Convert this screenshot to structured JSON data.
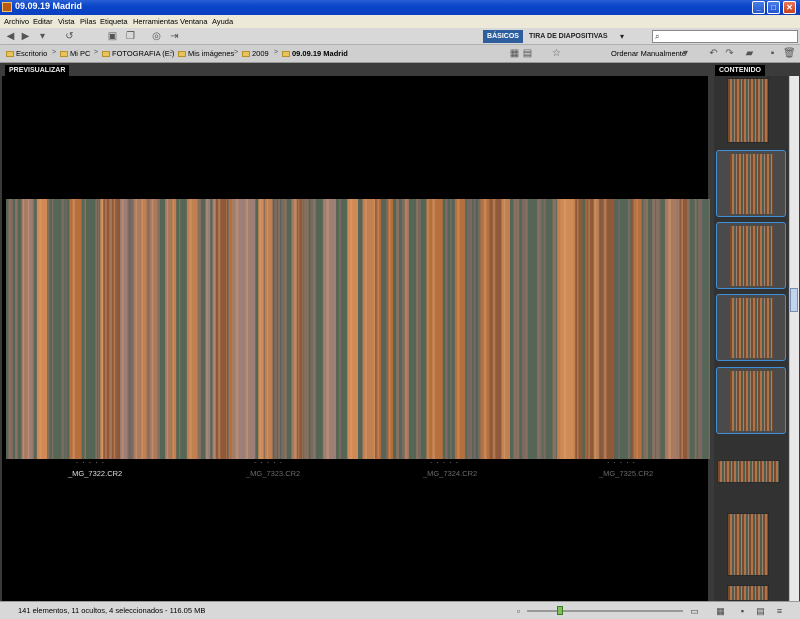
{
  "window": {
    "title": "09.09.19 Madrid"
  },
  "menu": [
    "Archivo",
    "Editar",
    "Vista",
    "Pilas",
    "Etiqueta",
    "Herramientas",
    "Ventana",
    "Ayuda"
  ],
  "toolbar": {
    "workspace_active": "BÁSICOS",
    "workspace_other": "TIRA DE DIAPOSITIVAS",
    "search_placeholder": "",
    "search_icon": "⌕"
  },
  "path": {
    "items": [
      "Escritorio",
      "Mi PC",
      "FOTOGRAFIA (E:)",
      "Mis imágenes",
      "2009",
      "09.09.19 Madrid"
    ],
    "sort_label": "Ordenar Manualmente"
  },
  "panels": {
    "preview_tab": "PREVISUALIZAR",
    "content_tab": "CONTENIDO"
  },
  "preview": {
    "stars": "· · · · ·",
    "files": [
      {
        "name": "_MG_7322.CR2",
        "color": "#e0e0e0"
      },
      {
        "name": "_MG_7323.CR2",
        "color": "#6a6a6a"
      },
      {
        "name": "_MG_7324.CR2",
        "color": "#6a6a6a"
      },
      {
        "name": "_MG_7325.CR2",
        "color": "#6a6a6a"
      }
    ]
  },
  "status": {
    "text": "141 elementos, 11 ocultos, 4 seleccionados - 116.05 MB",
    "zoom_level": 0.2
  }
}
